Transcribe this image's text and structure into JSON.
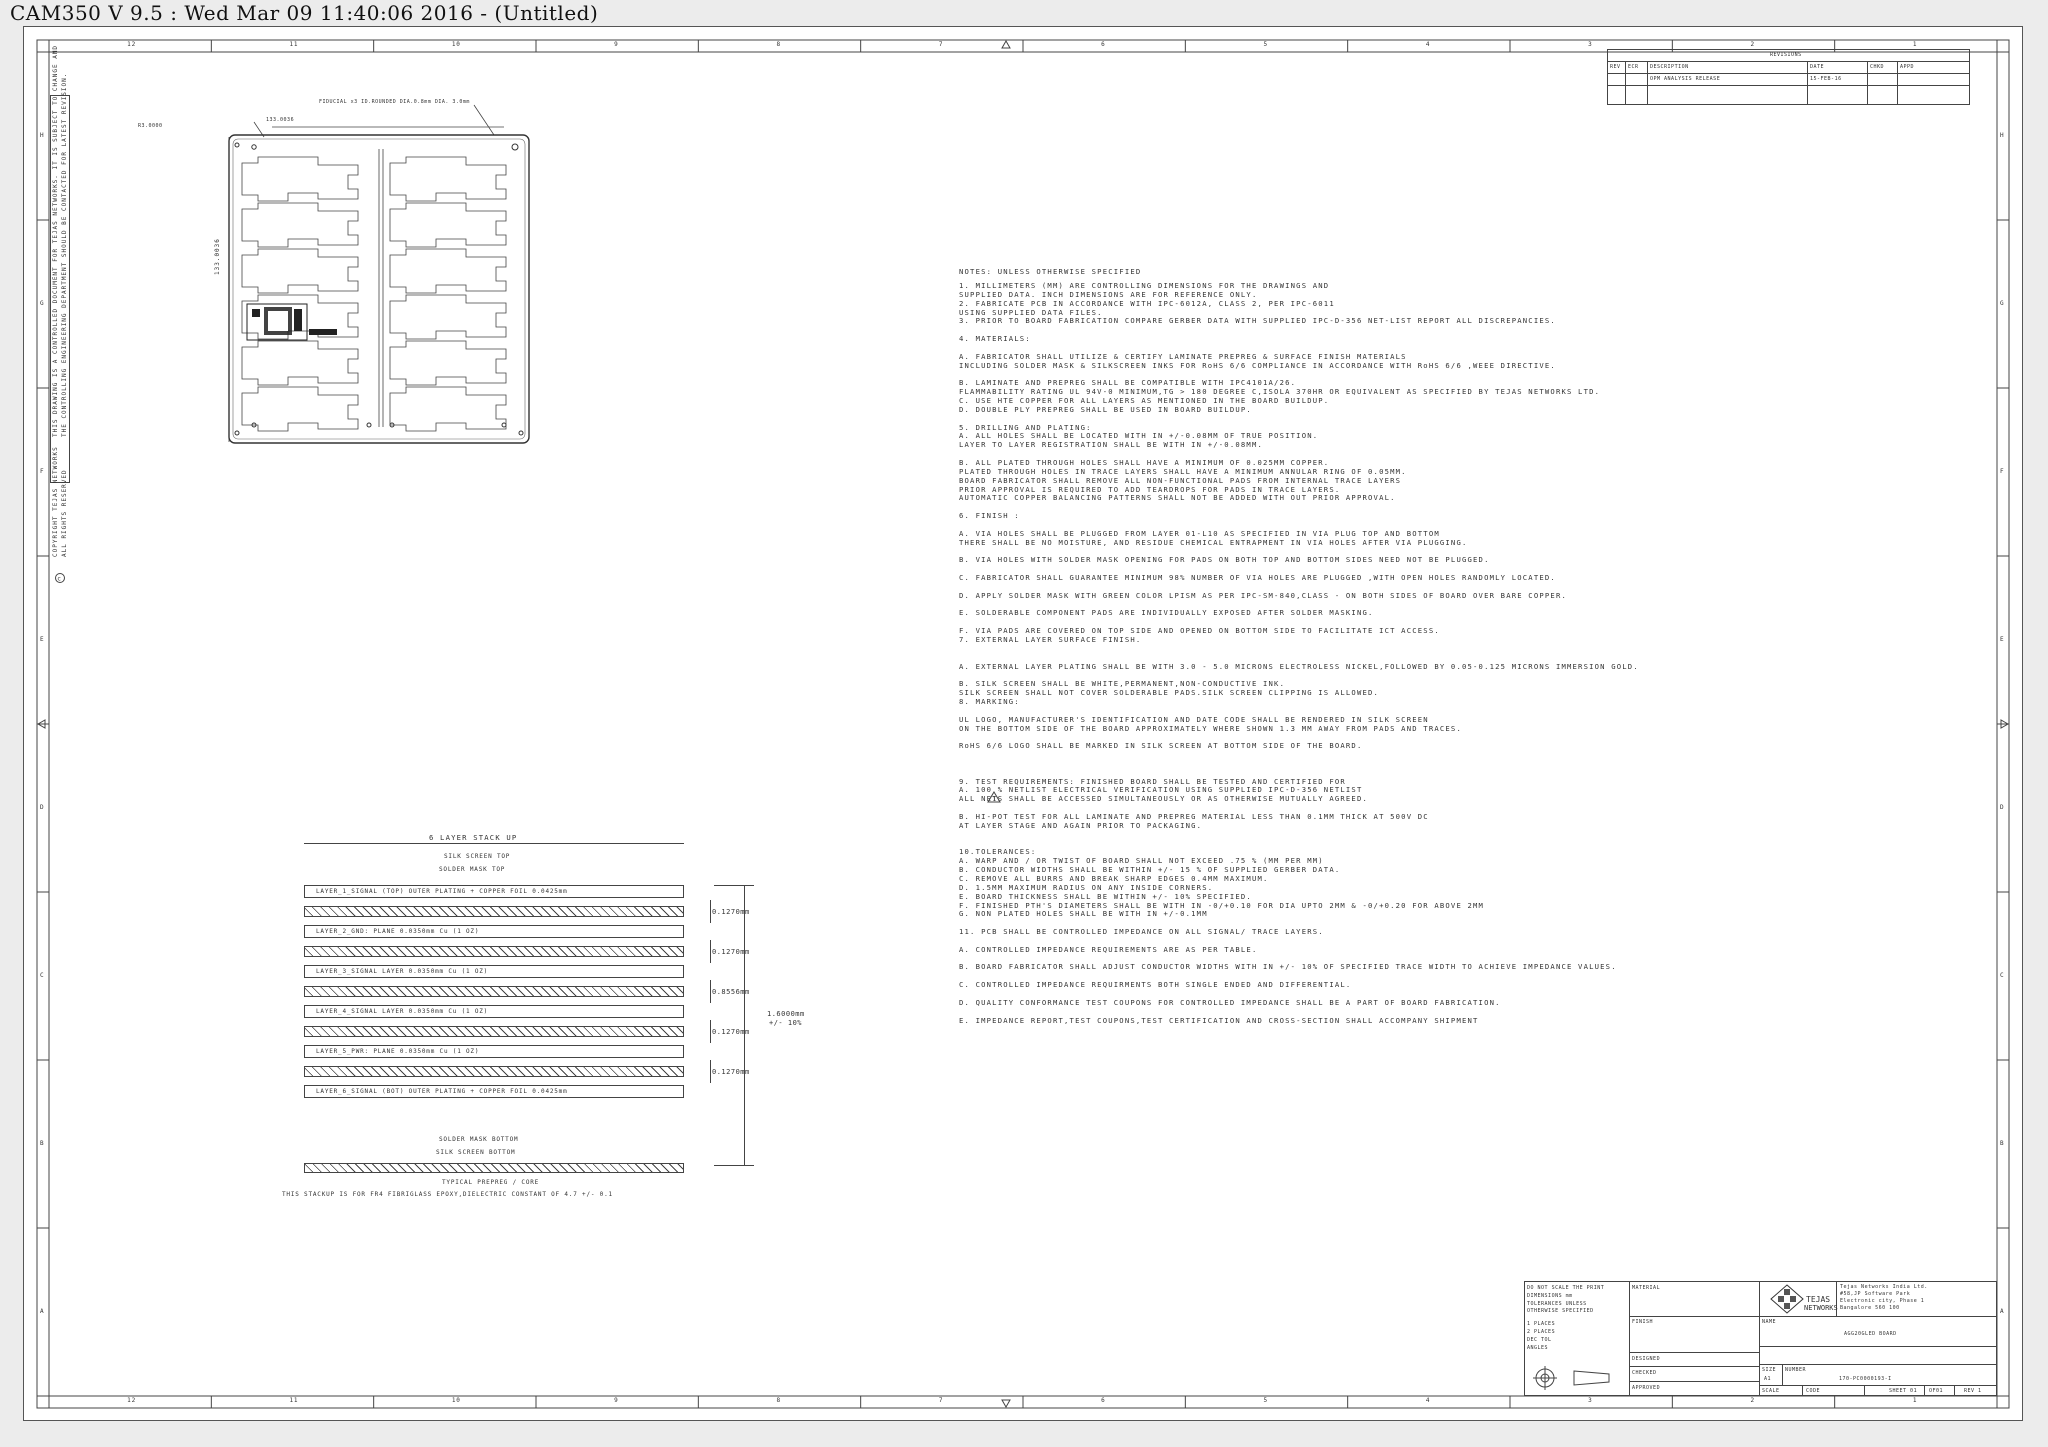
{
  "window": {
    "title": "CAM350 V 9.5 : Wed Mar 09 11:40:06 2016 - (Untitled)"
  },
  "frame": {
    "columns_top": [
      "12",
      "11",
      "10",
      "9",
      "8",
      "7",
      "6",
      "5",
      "4",
      "3",
      "2",
      "1"
    ],
    "columns_bottom": [
      "12",
      "11",
      "10",
      "9",
      "8",
      "7",
      "6",
      "5",
      "4",
      "3",
      "2",
      "1"
    ],
    "rows_left": [
      "H",
      "G",
      "F",
      "E",
      "D",
      "C",
      "B",
      "A"
    ],
    "rows_right": [
      "H",
      "G",
      "F",
      "E",
      "D",
      "C",
      "B",
      "A"
    ]
  },
  "side_legend": {
    "line1": "THIS DRAWING IS A CONTROLLED DOCUMENT FOR TEJAS NETWORKS. IT IS SUBJECT TO CHANGE AND",
    "line2": "THE CONTROLLING ENGINEERING DEPARTMENT SHOULD BE CONTACTED FOR LATEST REVISION.",
    "copyright1": "COPYRIGHT   TEJAS NETWORKS",
    "copyright2": "ALL RIGHTS RESERVED"
  },
  "revisions": {
    "title": "REVISIONS",
    "headers": [
      "REV",
      "ECR",
      "DESCRIPTION",
      "DATE",
      "CHKD",
      "APPD"
    ],
    "row": [
      "",
      "",
      "OPM ANALYSIS RELEASE",
      "15-FEB-16",
      "",
      ""
    ]
  },
  "panel": {
    "dim_top": "133.0036",
    "dim_left": "133.0036",
    "dim_corner": "R3.0000",
    "fiducial_note": "FIDUCIAL x3 ID.ROUNDED DIA.0.8mm DIA. 3.0mm"
  },
  "notes": {
    "heading": "NOTES: UNLESS OTHERWISE SPECIFIED",
    "lines": [
      "1. MILLIMETERS (MM) ARE CONTROLLING DIMENSIONS FOR THE DRAWINGS AND",
      "   SUPPLIED DATA.  INCH DIMENSIONS ARE FOR REFERENCE ONLY.",
      "2. FABRICATE PCB IN ACCORDANCE WITH IPC-6012A, CLASS 2, PER IPC-6011",
      "   USING  SUPPLIED DATA FILES.",
      "3. PRIOR TO BOARD FABRICATION COMPARE GERBER DATA WITH SUPPLIED IPC-D-356 NET-LIST REPORT ALL DISCREPANCIES.",
      "",
      "4. MATERIALS:",
      "",
      "   A. FABRICATOR SHALL UTILIZE & CERTIFY LAMINATE PREPREG & SURFACE FINISH MATERIALS",
      "      INCLUDING SOLDER MASK & SILKSCREEN INKS FOR RoHS 6/6  COMPLIANCE IN ACCORDANCE WITH RoHS 6/6 ,WEEE DIRECTIVE.",
      "",
      "   B. LAMINATE AND PREPREG SHALL BE COMPATIBLE WITH IPC4101A/26.",
      "      FLAMMABILITY RATING UL 94V-0 MINIMUM,TG  > 180 DEGREE C,ISOLA 370HR    OR EQUIVALENT AS SPECIFIED BY TEJAS NETWORKS LTD.",
      "   C. USE HTE COPPER FOR ALL LAYERS AS MENTIONED IN THE BOARD BUILDUP.",
      "   D. DOUBLE PLY PREPREG SHALL BE USED IN BOARD BUILDUP.",
      "",
      "5. DRILLING AND PLATING:",
      "   A. ALL HOLES SHALL BE LOCATED WITH IN +/-0.08MM OF TRUE POSITION.",
      "      LAYER TO LAYER REGISTRATION SHALL BE WITH IN +/-0.08MM.",
      "",
      "   B. ALL PLATED THROUGH HOLES SHALL HAVE A MINIMUM OF 0.025MM COPPER.",
      "      PLATED THROUGH HOLES IN TRACE LAYERS SHALL HAVE A MINIMUM ANNULAR RING OF 0.05MM.",
      "      BOARD FABRICATOR SHALL REMOVE ALL NON-FUNCTIONAL PADS FROM INTERNAL TRACE LAYERS",
      "      PRIOR APPROVAL IS REQUIRED TO ADD TEARDROPS FOR PADS IN TRACE LAYERS.",
      "      AUTOMATIC COPPER BALANCING PATTERNS SHALL NOT BE ADDED WITH OUT PRIOR APPROVAL.",
      "",
      "6. FINISH :",
      "",
      "   A. VIA HOLES SHALL BE PLUGGED FROM LAYER 01-L10 AS SPECIFIED IN VIA PLUG TOP  AND BOTTOM",
      "      THERE SHALL BE NO MOISTURE, AND RESIDUE CHEMICAL ENTRAPMENT IN VIA HOLES AFTER VIA PLUGGING.",
      "",
      "   B. VIA HOLES WITH SOLDER MASK OPENING FOR PADS ON BOTH TOP AND BOTTOM SIDES NEED NOT BE PLUGGED.",
      "",
      "   C. FABRICATOR SHALL GUARANTEE MINIMUM 98% NUMBER OF VIA HOLES ARE PLUGGED ,WITH OPEN HOLES RANDOMLY LOCATED.",
      "",
      "   D. APPLY SOLDER MASK WITH GREEN COLOR LPISM AS PER IPC-SM-840,CLASS - ON BOTH SIDES OF BOARD OVER BARE COPPER.",
      "",
      "   E. SOLDERABLE COMPONENT PADS ARE INDIVIDUALLY EXPOSED AFTER SOLDER MASKING.",
      "",
      "   F. VIA PADS ARE COVERED ON TOP SIDE AND OPENED ON BOTTOM SIDE TO FACILITATE ICT ACCESS.",
      "7. EXTERNAL LAYER SURFACE FINISH.",
      "",
      "",
      "   A. EXTERNAL LAYER PLATING SHALL BE WITH 3.0 - 5.0 MICRONS ELECTROLESS NICKEL,FOLLOWED BY 0.05-0.125 MICRONS IMMERSION GOLD.",
      "",
      "   B. SILK SCREEN SHALL BE WHITE,PERMANENT,NON-CONDUCTIVE INK.",
      "      SILK SCREEN SHALL NOT COVER SOLDERABLE PADS.SILK SCREEN CLIPPING IS ALLOWED.",
      "8. MARKING:",
      "",
      "      UL LOGO, MANUFACTURER'S IDENTIFICATION AND DATE CODE SHALL BE RENDERED IN SILK SCREEN",
      "      ON THE BOTTOM SIDE OF THE BOARD APPROXIMATELY WHERE SHOWN 1.3 MM AWAY FROM PADS AND TRACES.",
      "",
      "      RoHS 6/6 LOGO SHALL BE MARKED IN SILK SCREEN AT BOTTOM SIDE OF THE BOARD.",
      "",
      "",
      "",
      "9. TEST REQUIREMENTS: FINISHED BOARD SHALL BE TESTED AND CERTIFIED FOR",
      "   A. 100 % NETLIST ELECTRICAL VERIFICATION USING SUPPLIED IPC-D-356 NETLIST",
      "      ALL NETS SHALL BE ACCESSED SIMULTANEOUSLY OR AS OTHERWISE MUTUALLY AGREED.",
      "",
      "   B. HI-POT TEST FOR ALL LAMINATE AND PREPREG MATERIAL LESS THAN 0.1MM THICK AT 500V DC",
      "      AT LAYER STAGE AND AGAIN PRIOR TO PACKAGING.",
      "",
      "",
      "10.TOLERANCES:",
      "   A. WARP AND / OR TWIST OF BOARD SHALL NOT EXCEED .75 % (MM PER MM)",
      "   B. CONDUCTOR WIDTHS SHALL BE WITHIN +/- 15 % OF SUPPLIED GERBER DATA.",
      "   C. REMOVE ALL BURRS AND BREAK SHARP EDGES 0.4MM MAXIMUM.",
      "   D. 1.5MM MAXIMUM RADIUS ON ANY INSIDE CORNERS.",
      "   E. BOARD THICKNESS SHALL BE WITHIN +/- 10%  SPECIFIED.",
      "   F. FINISHED PTH'S DIAMETERS SHALL BE WITH IN -0/+0.10 FOR DIA UPTO 2MM & -0/+0.20 FOR ABOVE 2MM",
      "   G. NON PLATED HOLES SHALL BE WITH IN +/-0.1MM",
      "",
      "11. PCB SHALL BE CONTROLLED IMPEDANCE ON ALL SIGNAL/ TRACE LAYERS.",
      "",
      "   A. CONTROLLED IMPEDANCE REQUIREMENTS ARE AS PER TABLE.",
      "",
      "   B. BOARD FABRICATOR SHALL ADJUST CONDUCTOR WIDTHS WITH IN +/- 10% OF SPECIFIED TRACE WIDTH TO ACHIEVE IMPEDANCE VALUES.",
      "",
      "   C. CONTROLLED IMPEDANCE REQUIRMENTS BOTH SINGLE ENDED AND DIFFERENTIAL.",
      "",
      "   D. QUALITY CONFORMANCE TEST COUPONS FOR CONTROLLED IMPEDANCE SHALL BE A PART OF BOARD FABRICATION.",
      "",
      "   E. IMPEDANCE REPORT,TEST COUPONS,TEST CERTIFICATION AND CROSS-SECTION SHALL ACCOMPANY SHIPMENT"
    ]
  },
  "stackup": {
    "title": "6 LAYER STACK UP",
    "silk_top": "SILK SCREEN TOP",
    "mask_top": "SOLDER MASK TOP",
    "layers": [
      {
        "label": "LAYER_1_SIGNAL (TOP) OUTER PLATING + COPPER FOIL 0.0425mm",
        "kind": "copper"
      },
      {
        "label": "",
        "kind": "prepreg",
        "dim": "0.1270mm"
      },
      {
        "label": "LAYER_2_GND: PLANE 0.0350mm Cu (1 OZ)",
        "kind": "copper"
      },
      {
        "label": "",
        "kind": "prepreg",
        "dim": "0.1270mm"
      },
      {
        "label": "LAYER_3_SIGNAL LAYER 0.0350mm Cu (1 OZ)",
        "kind": "copper"
      },
      {
        "label": "",
        "kind": "prepreg",
        "dim": "0.8556mm"
      },
      {
        "label": "LAYER_4_SIGNAL LAYER 0.0350mm Cu (1 OZ)",
        "kind": "copper"
      },
      {
        "label": "",
        "kind": "prepreg",
        "dim": "0.1270mm"
      },
      {
        "label": "LAYER_5_PWR: PLANE 0.0350mm Cu (1 OZ)",
        "kind": "copper"
      },
      {
        "label": "",
        "kind": "prepreg",
        "dim": "0.1270mm"
      },
      {
        "label": "LAYER_6_SIGNAL (BOT) OUTER PLATING + COPPER FOIL 0.0425mm",
        "kind": "copper"
      }
    ],
    "total_thickness": "1.6000mm",
    "total_tol": "+/- 10%",
    "mask_bottom": "SOLDER MASK BOTTOM",
    "silk_bottom": "SILK SCREEN BOTTOM",
    "legend": "TYPICAL PREPREG / CORE",
    "footer": "THIS STACKUP IS FOR FR4 FIBRIGLASS EPOXY,DIELECTRIC CONSTANT OF 4.7 +/- 0.1"
  },
  "title_block": {
    "scale_note": "DO NOT SCALE THE PRINT",
    "dims_in": "DIMENSIONS mm",
    "tolerances_note": "TOLERANCES UNLESS",
    "otherwise": "OTHERWISE SPECIFIED",
    "tol1": "1 PLACES",
    "tol2": "2 PLACES",
    "tol3": "DEC TOL",
    "tol4": "ANGLES",
    "material": "MATERIAL",
    "finish": "FINISH",
    "designed": "DESIGNED",
    "checked": "CHECKED",
    "approved": "APPROVED",
    "company": "TEJAS",
    "company2": "NETWORKS",
    "addr1": "Tejas Networks India  Ltd.",
    "addr2": "#58,JP Software Park",
    "addr3": "Electronic city, Phase 1",
    "addr4": "Bangalore 560 100",
    "name_label": "NAME",
    "name_value": "AGG20GLED BOARD",
    "size_label": "SIZE",
    "size_value": "A1",
    "number_label": "NUMBER",
    "number_value": "170-PC0000193-I",
    "scale_label": "SCALE",
    "code_label": "CODE",
    "sheet": "SHEET 01",
    "of": "OF01",
    "rev": "REV 1"
  }
}
